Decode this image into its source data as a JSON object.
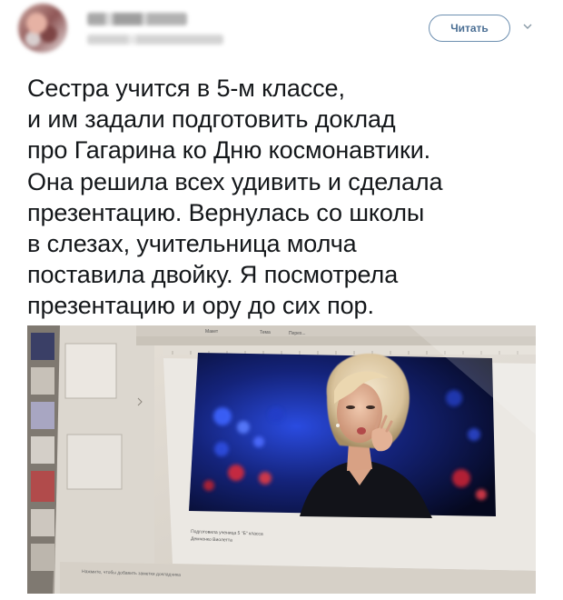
{
  "header": {
    "follow_label": "Читать"
  },
  "tweet": {
    "lines": [
      "Сестра учится в 5-м классе,",
      "и им задали подготовить доклад",
      "про Гагарина ко Дню космонавтики.",
      "Она решила всех удивить и сделала",
      "презентацию. Вернулась со школы",
      "в слезах, учительница молча",
      "поставила двойку. Я посмотрела",
      "презентацию и ору до сих пор."
    ]
  },
  "photo": {
    "toolbar": {
      "layout_label": "Макет",
      "theme_label": "Тема",
      "transitions_label": "Перех..."
    },
    "slide_caption": {
      "line1": "Подготовила ученица 5 \"Б\" класса",
      "line2": "Демченко Виолетта"
    },
    "notes_hint": "Нажмите, чтобы добавить заметки докладчика",
    "colors": {
      "slide_bg": "#e9e6e2",
      "stage_blue": "#1c3cc4"
    }
  }
}
